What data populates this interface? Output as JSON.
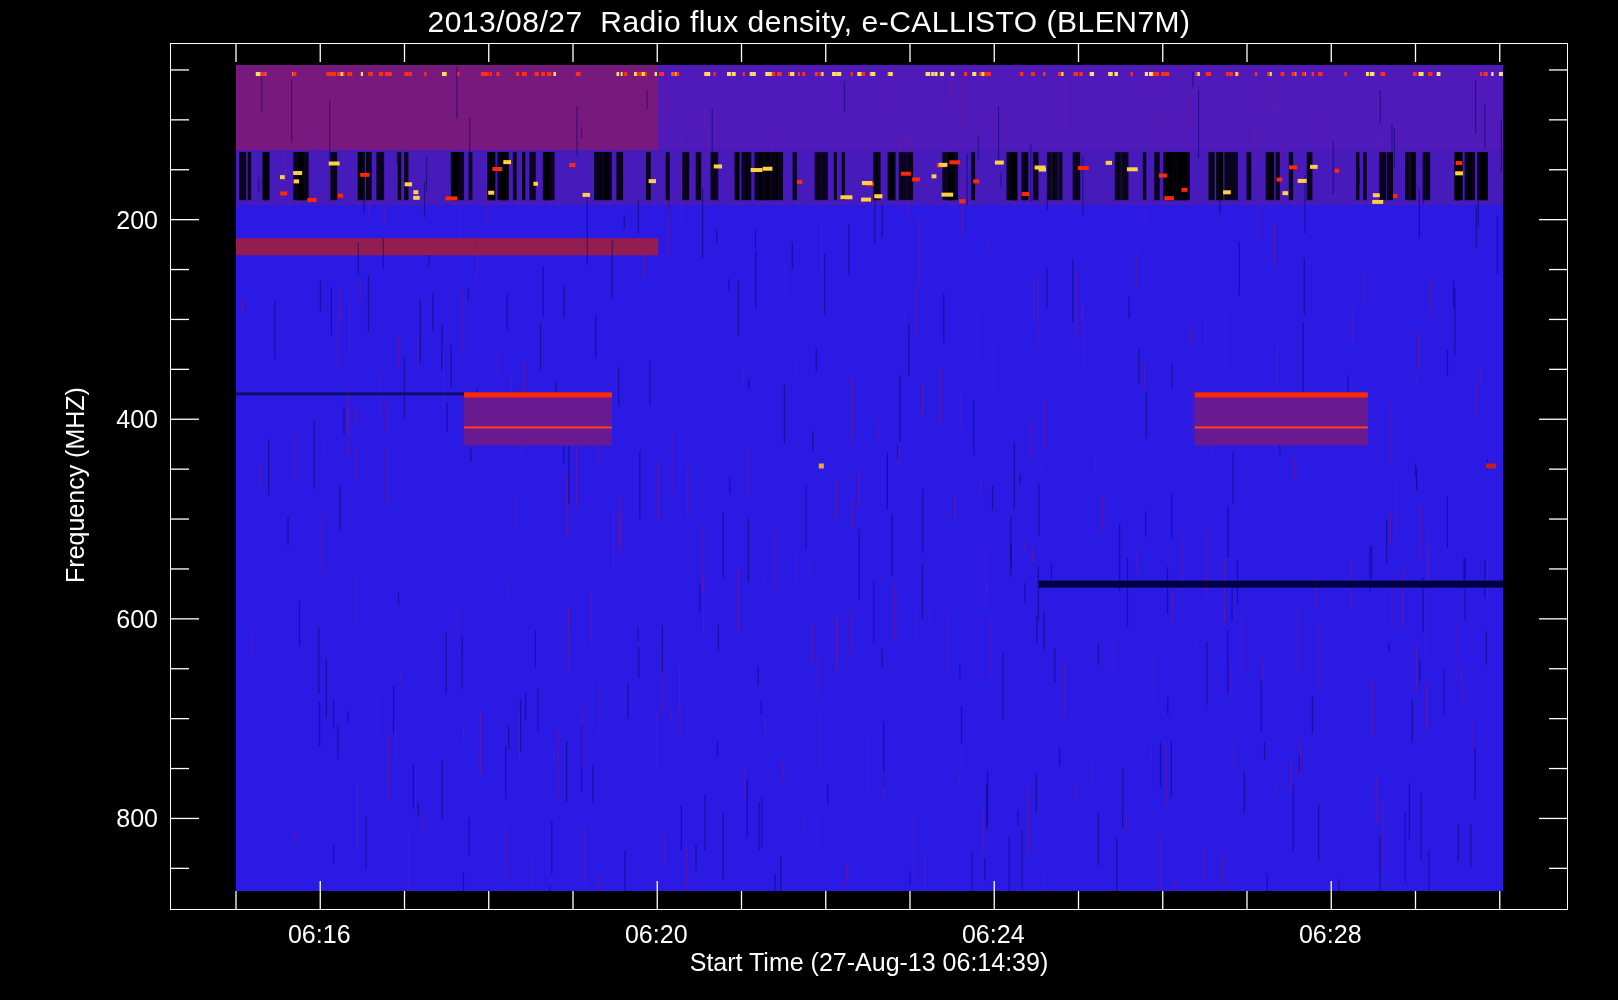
{
  "title": "2013/08/27  Radio flux density, e-CALLISTO (BLEN7M)",
  "y_axis": {
    "label": "Frequency (MHZ)",
    "tick_labels": [
      "200",
      "400",
      "600",
      "800"
    ]
  },
  "x_axis": {
    "label": "Start Time (27-Aug-13 06:14:39)",
    "tick_labels": [
      "06:16",
      "06:20",
      "06:24",
      "06:28"
    ]
  }
}
